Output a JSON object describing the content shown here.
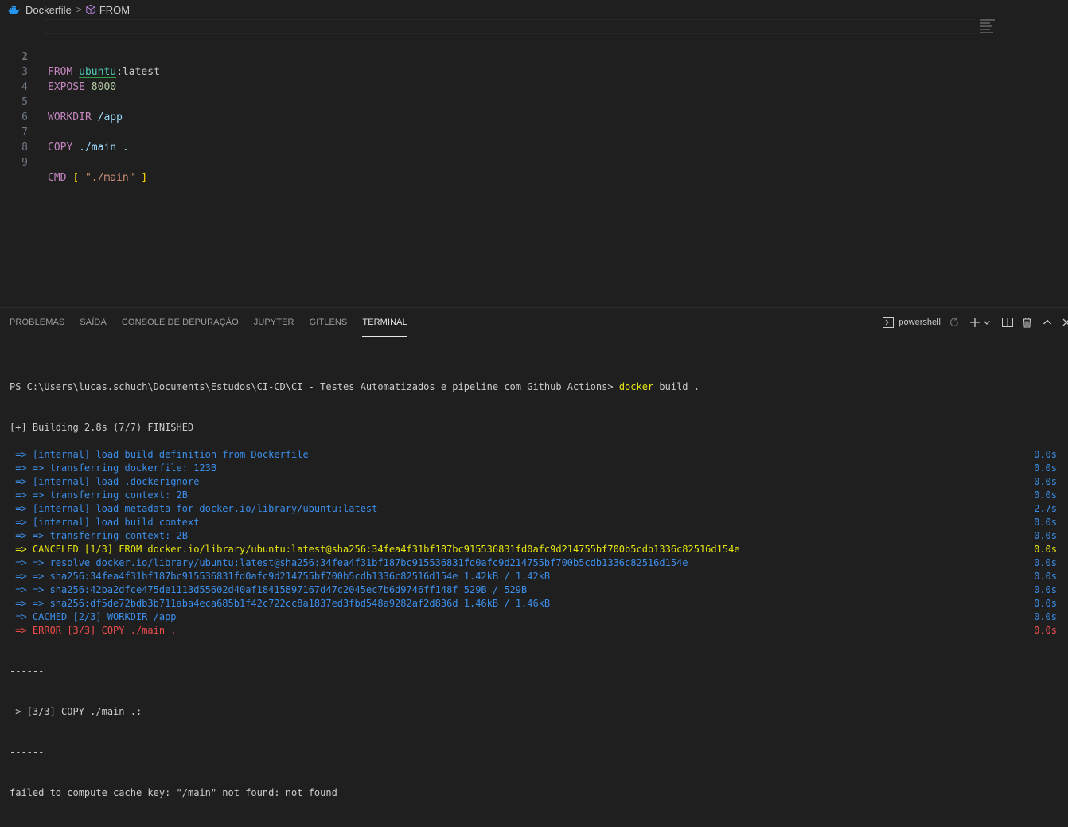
{
  "breadcrumb": {
    "file": "Dockerfile",
    "symbol": "FROM"
  },
  "editor": {
    "lines": [
      {
        "n": "1"
      },
      {
        "n": "2"
      },
      {
        "n": "3"
      },
      {
        "n": "4"
      },
      {
        "n": "5"
      },
      {
        "n": "6"
      },
      {
        "n": "7"
      },
      {
        "n": "8"
      },
      {
        "n": "9"
      }
    ],
    "l1": {
      "kw": "FROM",
      "image": "ubuntu",
      "rest": ":latest"
    },
    "l3": {
      "kw": "EXPOSE",
      "num": "8000"
    },
    "l5": {
      "kw": "WORKDIR",
      "path": "/app"
    },
    "l7": {
      "kw": "COPY",
      "path": "./main ."
    },
    "l9": {
      "kw": "CMD",
      "open": "[",
      "str": "\"./main\"",
      "close": "]"
    }
  },
  "panel": {
    "tabs": [
      "PROBLEMAS",
      "SAÍDA",
      "CONSOLE DE DEPURAÇÃO",
      "JUPYTER",
      "GITLENS",
      "TERMINAL"
    ],
    "shell": "powershell"
  },
  "terminal": {
    "prompt": "PS C:\\Users\\lucas.schuch\\Documents\\Estudos\\CI-CD\\CI - Testes Automatizados e pipeline com Github Actions> ",
    "cmd": "docker",
    "args": " build .",
    "building": "[+] Building 2.8s (7/7) FINISHED",
    "steps": [
      {
        "text": " => [internal] load build definition from Dockerfile",
        "time": "0.0s",
        "color": "blue"
      },
      {
        "text": " => => transferring dockerfile: 123B",
        "time": "0.0s",
        "color": "blue"
      },
      {
        "text": " => [internal] load .dockerignore",
        "time": "0.0s",
        "color": "blue"
      },
      {
        "text": " => => transferring context: 2B",
        "time": "0.0s",
        "color": "blue"
      },
      {
        "text": " => [internal] load metadata for docker.io/library/ubuntu:latest",
        "time": "2.7s",
        "color": "blue"
      },
      {
        "text": " => [internal] load build context",
        "time": "0.0s",
        "color": "blue"
      },
      {
        "text": " => => transferring context: 2B",
        "time": "0.0s",
        "color": "blue"
      },
      {
        "text": " => CANCELED [1/3] FROM docker.io/library/ubuntu:latest@sha256:34fea4f31bf187bc915536831fd0afc9d214755bf700b5cdb1336c82516d154e",
        "time": "0.0s",
        "color": "yellow"
      },
      {
        "text": " => => resolve docker.io/library/ubuntu:latest@sha256:34fea4f31bf187bc915536831fd0afc9d214755bf700b5cdb1336c82516d154e",
        "time": "0.0s",
        "color": "blue"
      },
      {
        "text": " => => sha256:34fea4f31bf187bc915536831fd0afc9d214755bf700b5cdb1336c82516d154e 1.42kB / 1.42kB",
        "time": "0.0s",
        "color": "blue"
      },
      {
        "text": " => => sha256:42ba2dfce475de1113d55602d40af18415897167d47c2045ec7b6d9746ff148f 529B / 529B",
        "time": "0.0s",
        "color": "blue"
      },
      {
        "text": " => => sha256:df5de72bdb3b711aba4eca685b1f42c722cc8a1837ed3fbd548a9282af2d836d 1.46kB / 1.46kB",
        "time": "0.0s",
        "color": "blue"
      },
      {
        "text": " => CACHED [2/3] WORKDIR /app",
        "time": "0.0s",
        "color": "blue"
      },
      {
        "text": " => ERROR [3/3] COPY ./main .",
        "time": "0.0s",
        "color": "red"
      }
    ],
    "sep1": "------",
    "copy_line": " > [3/3] COPY ./main .:",
    "sep2": "------",
    "error": "failed to compute cache key: \"/main\" not found: not found"
  }
}
